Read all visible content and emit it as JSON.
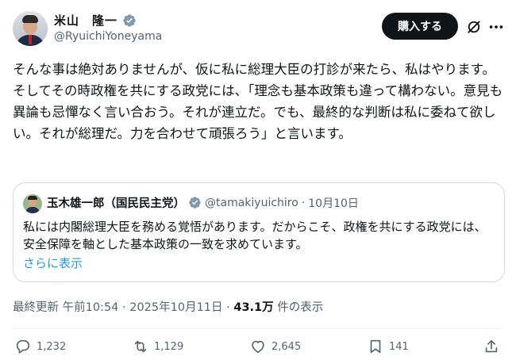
{
  "author": {
    "display_name": "米山　隆一",
    "handle": "@RyuichiYoneyama",
    "verified_icon": "verified-badge-icon"
  },
  "header": {
    "buy_label": "購入する",
    "grok_icon": "grok-icon",
    "more_icon": "more-icon"
  },
  "tweet": {
    "text": "そんな事は絶対ありませんが、仮に私に総理大臣の打診が来たら、私はやります。そしてその時政権を共にする政党には、「理念も基本政策も違って構わない。意見も異論も忌憚なく言い合おう。それが連立だ。でも、最終的な判断は私に委ねて欲しい。それが総理だ。力を合わせて頑張ろう」と言います。"
  },
  "quote": {
    "display_name": "玉木雄一郎（国民民主党）",
    "handle": "@tamakiyuichiro",
    "separator": "·",
    "date": "10月10日",
    "text": "私には内閣総理大臣を務める覚悟があります。だからこそ、政権を共にする政党には、安全保障を軸とした基本政策の一致を求めています。",
    "show_more": "さらに表示"
  },
  "meta": {
    "prefix": "最終更新 午前10:54 · 2025年10月11日 · ",
    "views": "43.1万",
    "views_suffix": " 件の表示"
  },
  "actions": {
    "replies": "1,232",
    "reposts": "1,129",
    "likes": "2,645",
    "bookmarks": "141"
  },
  "colors": {
    "accent": "#1d9bf0",
    "muted": "#536471",
    "text": "#0f1419",
    "verified": "#829aab"
  }
}
